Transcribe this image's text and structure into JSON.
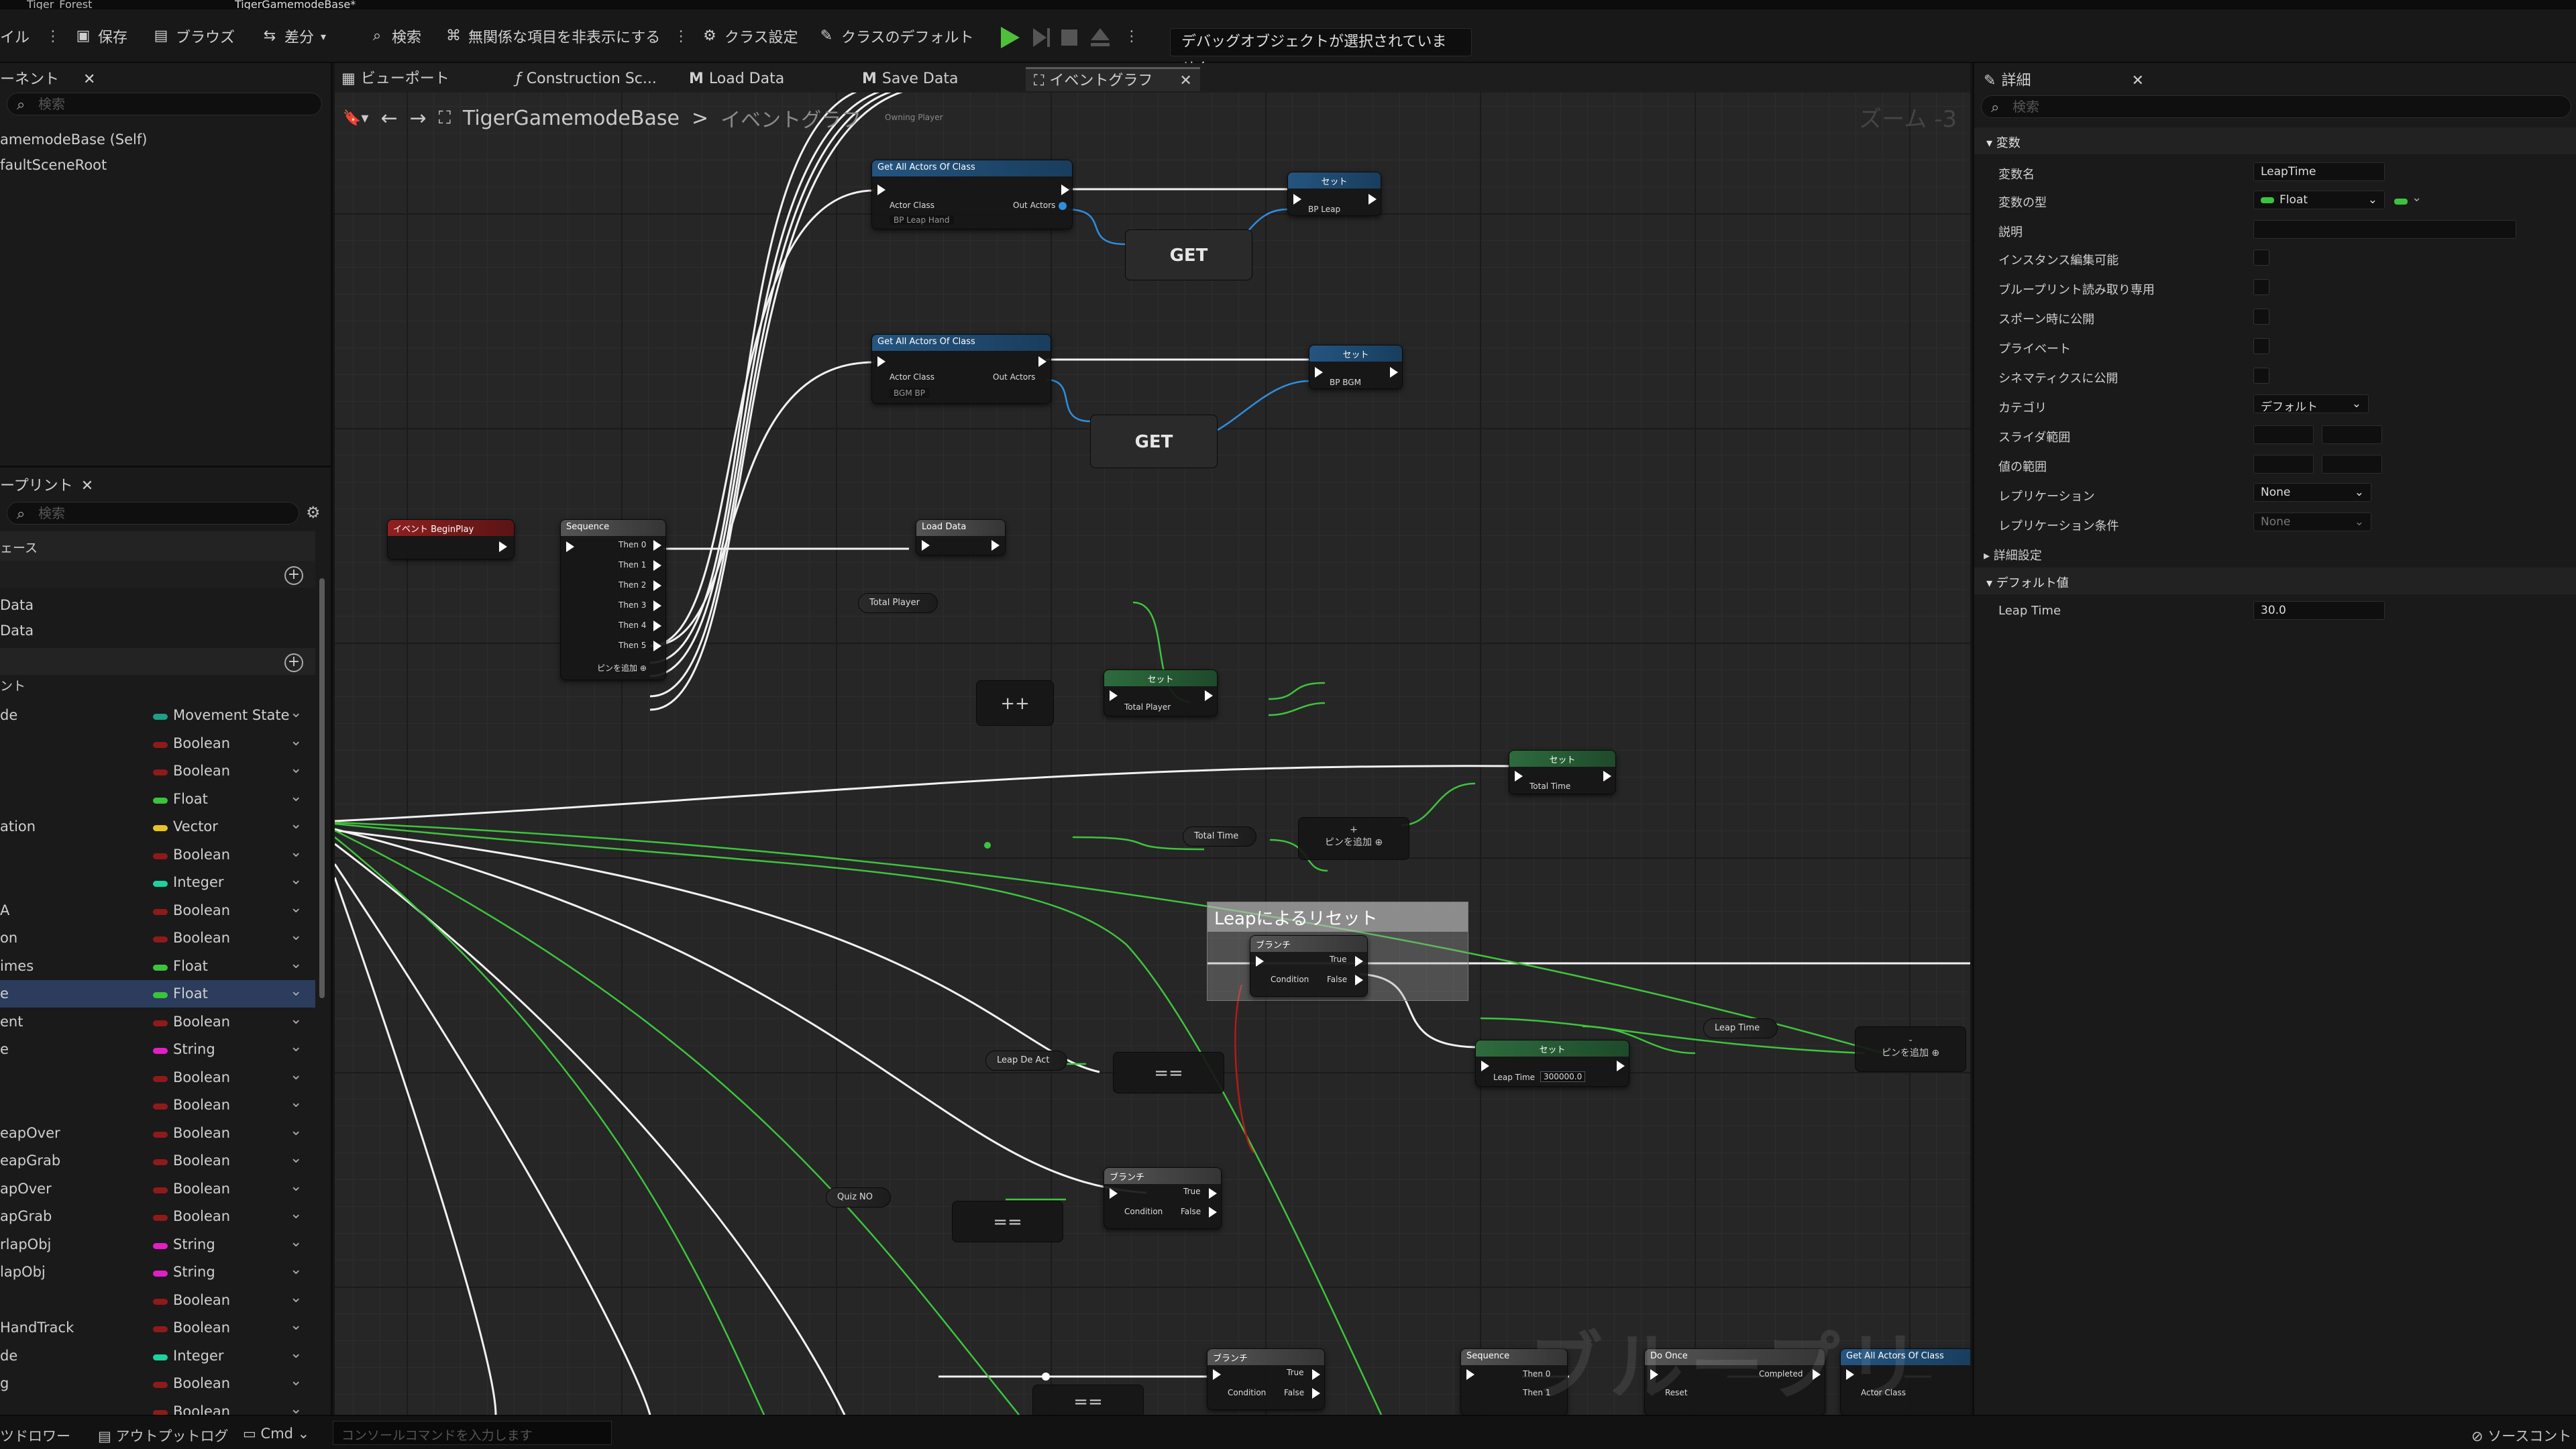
{
  "doc_tabs": [
    "Tiger_Forest",
    "TigerGamemodeBase*"
  ],
  "toolbar": {
    "file": "イル",
    "save": "保存",
    "browse": "ブラウズ",
    "diff": "差分",
    "search": "検索",
    "hide_unrelated": "無関係な項目を非表示にする",
    "class_settings": "クラス設定",
    "class_defaults": "クラスのデフォルト",
    "debug_dropdown": "デバッグオブジェクトが選択されていません"
  },
  "left": {
    "components_tab": "ーネント",
    "search_placeholder": "検索",
    "components": [
      "amemodeBase (Self)",
      "faultSceneRoot"
    ],
    "myblueprint_tab": "ープリント",
    "interfaces_label": "ェース",
    "items_data": [
      "Data",
      "Data"
    ],
    "vars_label": "ント",
    "variables": [
      {
        "name": "de",
        "type": "Movement State",
        "color": "#1f9f86"
      },
      {
        "name": "",
        "type": "Boolean",
        "color": "#8f1a1a"
      },
      {
        "name": "",
        "type": "Boolean",
        "color": "#8f1a1a"
      },
      {
        "name": "",
        "type": "Float",
        "color": "#3bc43b"
      },
      {
        "name": "ation",
        "type": "Vector",
        "color": "#e8c41f"
      },
      {
        "name": "",
        "type": "Boolean",
        "color": "#8f1a1a"
      },
      {
        "name": "",
        "type": "Integer",
        "color": "#1fd0a0"
      },
      {
        "name": "A",
        "type": "Boolean",
        "color": "#8f1a1a"
      },
      {
        "name": "on",
        "type": "Boolean",
        "color": "#8f1a1a"
      },
      {
        "name": "imes",
        "type": "Float",
        "color": "#3bc43b"
      },
      {
        "name": "e",
        "type": "Float",
        "color": "#3bc43b",
        "selected": true
      },
      {
        "name": "ent",
        "type": "Boolean",
        "color": "#8f1a1a"
      },
      {
        "name": "e",
        "type": "String",
        "color": "#e21fc4"
      },
      {
        "name": "",
        "type": "Boolean",
        "color": "#8f1a1a"
      },
      {
        "name": "",
        "type": "Boolean",
        "color": "#8f1a1a"
      },
      {
        "name": "eapOver",
        "type": "Boolean",
        "color": "#8f1a1a"
      },
      {
        "name": "eapGrab",
        "type": "Boolean",
        "color": "#8f1a1a"
      },
      {
        "name": "apOver",
        "type": "Boolean",
        "color": "#8f1a1a"
      },
      {
        "name": "apGrab",
        "type": "Boolean",
        "color": "#8f1a1a"
      },
      {
        "name": "rlapObj",
        "type": "String",
        "color": "#e21fc4"
      },
      {
        "name": "lapObj",
        "type": "String",
        "color": "#e21fc4"
      },
      {
        "name": "",
        "type": "Boolean",
        "color": "#8f1a1a"
      },
      {
        "name": "HandTrack",
        "type": "Boolean",
        "color": "#8f1a1a"
      },
      {
        "name": "de",
        "type": "Integer",
        "color": "#1fd0a0"
      },
      {
        "name": "g",
        "type": "Boolean",
        "color": "#8f1a1a"
      },
      {
        "name": "",
        "type": "Boolean",
        "color": "#8f1a1a"
      }
    ]
  },
  "graph_tabs": {
    "viewport": "ビューポート",
    "construction": "Construction Sc...",
    "load_data": "Load Data",
    "save_data": "Save Data",
    "event_graph": "イベントグラフ"
  },
  "graph": {
    "breadcrumb_root": "TigerGamemodeBase",
    "breadcrumb_sep": ">",
    "breadcrumb_leaf": "イベントグラフ",
    "zoom": "ズーム -3",
    "watermark": "ブループリント",
    "nodes": {
      "get_all_1": "Get All Actors Of Class",
      "actor_class": "Actor Class",
      "out_actors": "Out Actors",
      "bp_leap_class": "BP Leap Hand",
      "set": "セット",
      "bp_leap": "BP Leap",
      "get": "GET",
      "get_all_2": "Get All Actors Of Class",
      "bgm_class": "BGM BP",
      "bp_bgm": "BP BGM",
      "begin_play": "イベント BeginPlay",
      "sequence": "Sequence",
      "then": [
        "Then 0",
        "Then 1",
        "Then 2",
        "Then 3",
        "Then 4",
        "Then 5"
      ],
      "add_pin": "ピンを追加",
      "load_data": "Load Data",
      "total_player": "Total Player",
      "plusplus": "++",
      "total_time": "Total Time",
      "comment": "Leapによるリセット",
      "branch": "ブランチ",
      "true": "True",
      "false": "False",
      "condition": "Condition",
      "leap_time": "Leap Time",
      "leap_time_value": "300000.0",
      "leap_de_act": "Leap De Act",
      "quiz_no": "Quiz NO",
      "eq": "==",
      "do_once": "Do Once",
      "completed": "Completed",
      "reset": "Reset",
      "get_all_3": "Get All Actors Of Class",
      "owning_player": "Owning Player"
    }
  },
  "details": {
    "tab": "詳細",
    "search_placeholder": "検索",
    "section_var": "変数",
    "var_name_label": "変数名",
    "var_name_value": "LeapTime",
    "var_type_label": "変数の型",
    "var_type_value": "Float",
    "desc_label": "説明",
    "instance_editable": "インスタンス編集可能",
    "bp_readonly": "ブループリント読み取り専用",
    "expose_spawn": "スポーン時に公開",
    "private": "プライベート",
    "expose_cinematics": "シネマティクスに公開",
    "category_label": "カテゴリ",
    "category_value": "デフォルト",
    "slider_range": "スライダ範囲",
    "value_range": "値の範囲",
    "replication_label": "レプリケーション",
    "replication_value": "None",
    "rep_condition_label": "レプリケーション条件",
    "rep_condition_value": "None",
    "advanced": "詳細設定",
    "default_section": "デフォルト値",
    "leap_time_label": "Leap Time",
    "leap_time_value": "30.0"
  },
  "status": {
    "drawer": "ツドロワー",
    "output_log": "アウトプットログ",
    "cmd": "Cmd",
    "console_placeholder": "コンソールコマンドを入力します",
    "source_control": "ソースコント"
  }
}
